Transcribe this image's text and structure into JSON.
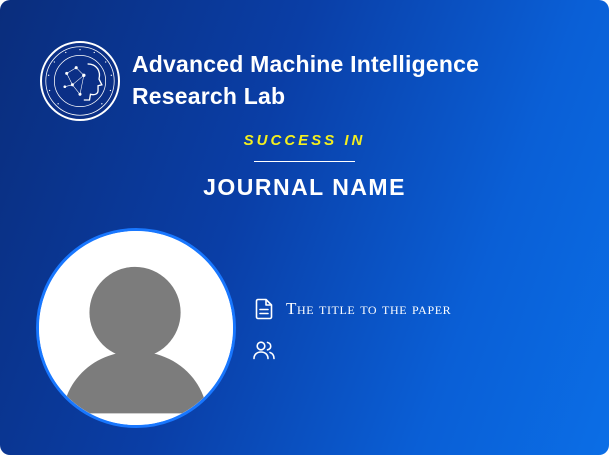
{
  "lab": {
    "name_line1": "Advanced Machine Intelligence",
    "name_line2": "Research Lab"
  },
  "badge": {
    "success_label": "SUCCESS IN",
    "journal_name": "JOURNAL NAME"
  },
  "paper": {
    "title": "The title to the paper",
    "authors": ""
  },
  "colors": {
    "background_start": "#0a2d7c",
    "background_end": "#0b6ee6",
    "accent_yellow": "#f3ef1f",
    "avatar_ring": "#1877ff",
    "avatar_silhouette": "#7c7c7c"
  },
  "icons": {
    "paper": "document-icon",
    "authors": "users-icon",
    "logo": "lab-logo",
    "avatar": "avatar-placeholder"
  }
}
